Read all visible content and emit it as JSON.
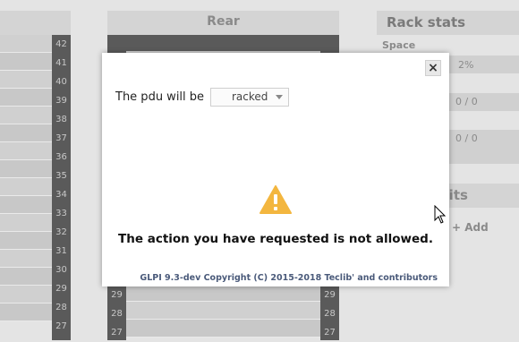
{
  "rear": {
    "header": "Rear"
  },
  "front": {
    "units": [
      "42",
      "41",
      "40",
      "39",
      "38",
      "37",
      "36",
      "35",
      "34",
      "33",
      "32",
      "31",
      "30",
      "29",
      "28",
      "27"
    ]
  },
  "rear_units_bottom": [
    "29",
    "28",
    "27"
  ],
  "stats": {
    "title": "Rack stats",
    "space_label": "Space",
    "space_value": "2%",
    "val1": "0 / 0",
    "val2": "0 / 0",
    "units_title": "nits",
    "add_label": "+ Add"
  },
  "modal": {
    "close_symbol": "×",
    "prompt": "The pdu will be",
    "select_value": "racked",
    "message": "The action you have requested is not allowed.",
    "footer": "GLPI 9.3-dev Copyright (C) 2015-2018 Teclib' and contributors"
  },
  "colors": {
    "warning": "#f3b63f",
    "footer": "#4a5a7a"
  }
}
